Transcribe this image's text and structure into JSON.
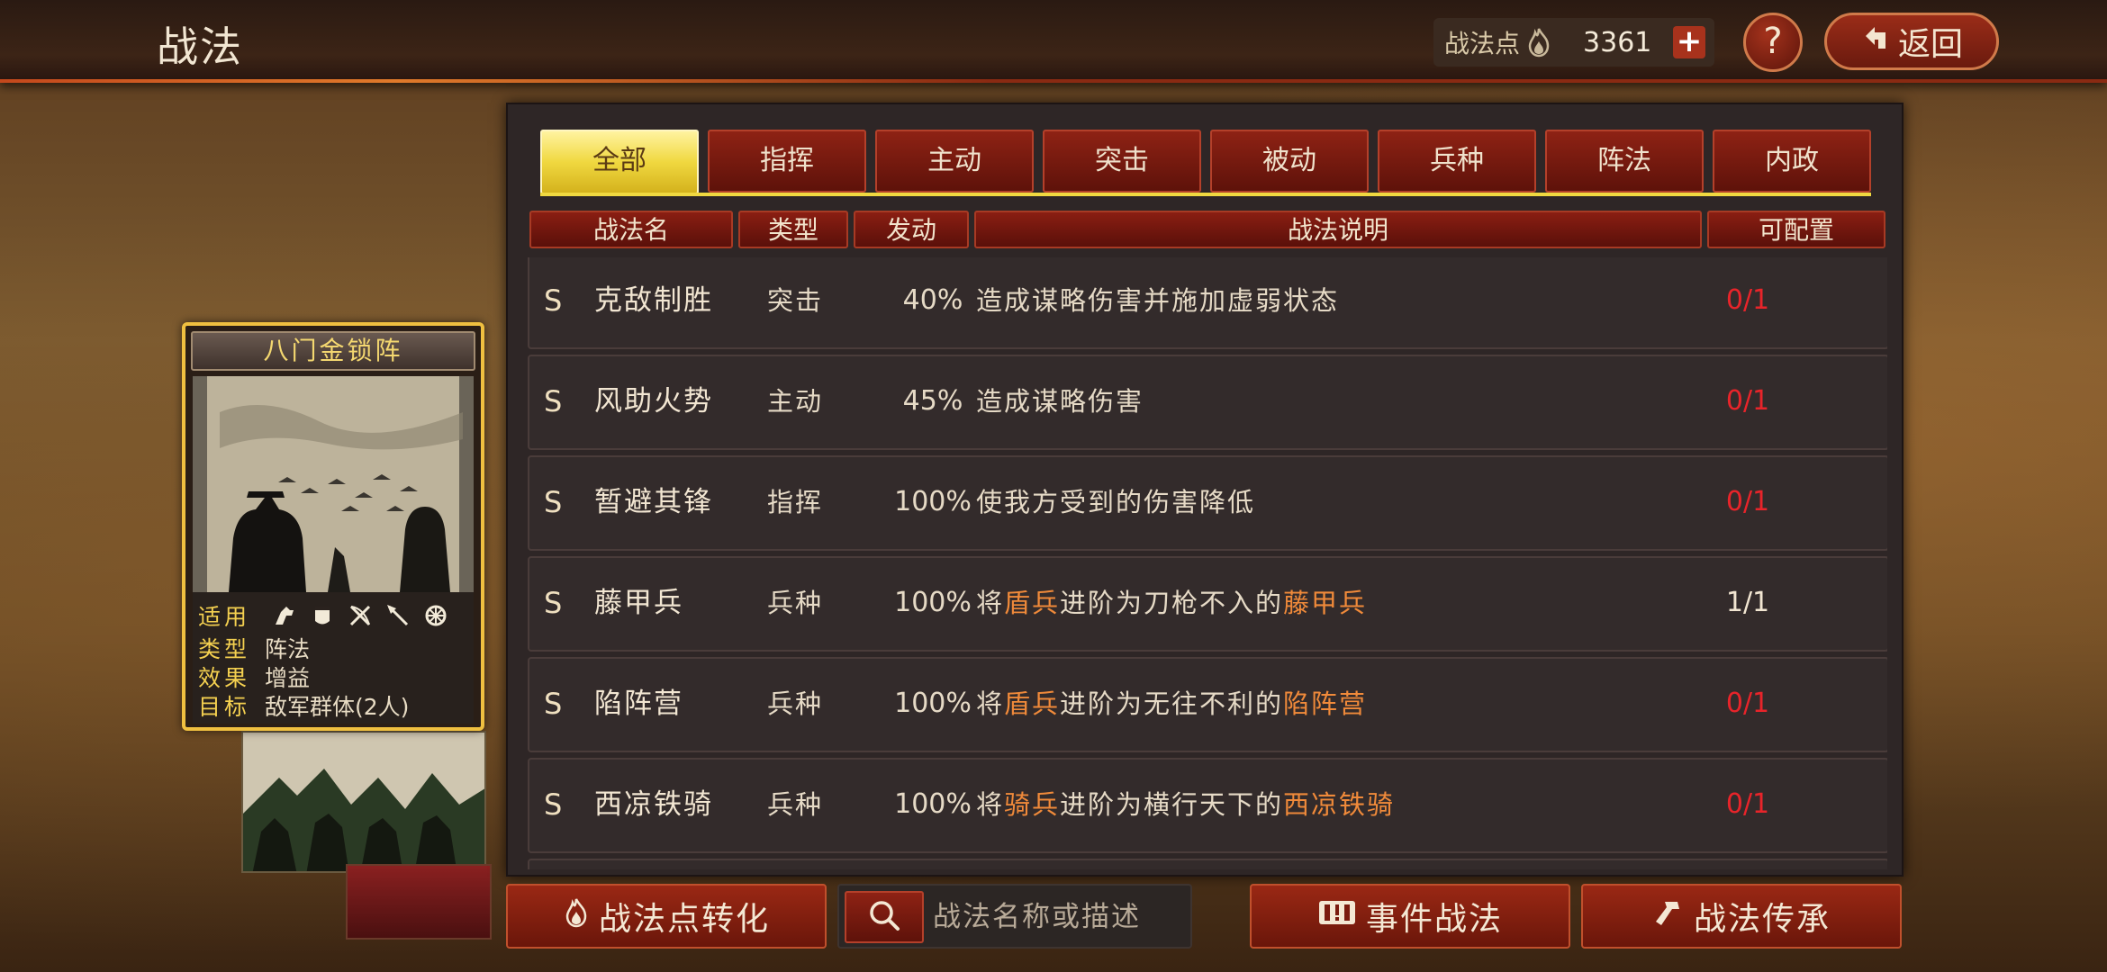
{
  "header": {
    "title": "战法",
    "points_label": "战法点",
    "points_value": "3361",
    "plus_label": "+",
    "help_label": "?",
    "back_label": "返回"
  },
  "tabs": [
    {
      "label": "全部",
      "active": true
    },
    {
      "label": "指挥"
    },
    {
      "label": "主动"
    },
    {
      "label": "突击"
    },
    {
      "label": "被动"
    },
    {
      "label": "兵种"
    },
    {
      "label": "阵法"
    },
    {
      "label": "内政"
    }
  ],
  "columns": {
    "name": "战法名",
    "type": "类型",
    "rate": "发动",
    "desc": "战法说明",
    "cap": "可配置"
  },
  "rows": [
    {
      "grade": "S",
      "name": "克敌制胜",
      "type": "突击",
      "rate": "40%",
      "desc": [
        {
          "t": "造成谋略伤害并施加虚弱状态"
        }
      ],
      "cap": "0/1",
      "cap_full": false
    },
    {
      "grade": "S",
      "name": "风助火势",
      "type": "主动",
      "rate": "45%",
      "desc": [
        {
          "t": "造成谋略伤害"
        }
      ],
      "cap": "0/1",
      "cap_full": false
    },
    {
      "grade": "S",
      "name": "暂避其锋",
      "type": "指挥",
      "rate": "100%",
      "desc": [
        {
          "t": "使我方受到的伤害降低"
        }
      ],
      "cap": "0/1",
      "cap_full": false
    },
    {
      "grade": "S",
      "name": "藤甲兵",
      "type": "兵种",
      "rate": "100%",
      "desc": [
        {
          "t": "将"
        },
        {
          "t": "盾兵",
          "hl": true
        },
        {
          "t": "进阶为刀枪不入的"
        },
        {
          "t": "藤甲兵",
          "hl": true
        }
      ],
      "cap": "1/1",
      "cap_full": true
    },
    {
      "grade": "S",
      "name": "陷阵营",
      "type": "兵种",
      "rate": "100%",
      "desc": [
        {
          "t": "将"
        },
        {
          "t": "盾兵",
          "hl": true
        },
        {
          "t": "进阶为无往不利的"
        },
        {
          "t": "陷阵营",
          "hl": true
        }
      ],
      "cap": "0/1",
      "cap_full": false
    },
    {
      "grade": "S",
      "name": "西凉铁骑",
      "type": "兵种",
      "rate": "100%",
      "desc": [
        {
          "t": "将"
        },
        {
          "t": "骑兵",
          "hl": true
        },
        {
          "t": "进阶为横行天下的"
        },
        {
          "t": "西凉铁骑",
          "hl": true
        }
      ],
      "cap": "0/1",
      "cap_full": false
    }
  ],
  "card": {
    "title": "八门金锁阵",
    "apply_label": "适用",
    "type_label": "类型",
    "type_value": "阵法",
    "effect_label": "效果",
    "effect_value": "增益",
    "target_label": "目标",
    "target_value": "敌军群体(2人)",
    "troop_icons": [
      "cavalry-icon",
      "shield-icon",
      "archer-icon",
      "spear-icon",
      "siege-icon"
    ]
  },
  "bottom": {
    "convert_label": "战法点转化",
    "search_placeholder": "战法名称或描述",
    "event_label": "事件战法",
    "inherit_label": "战法传承"
  },
  "colors": {
    "accent_red": "#8a1e12",
    "tab_active": "#f0d840",
    "cap_empty": "#e8242a",
    "highlight": "#f08a3a"
  }
}
